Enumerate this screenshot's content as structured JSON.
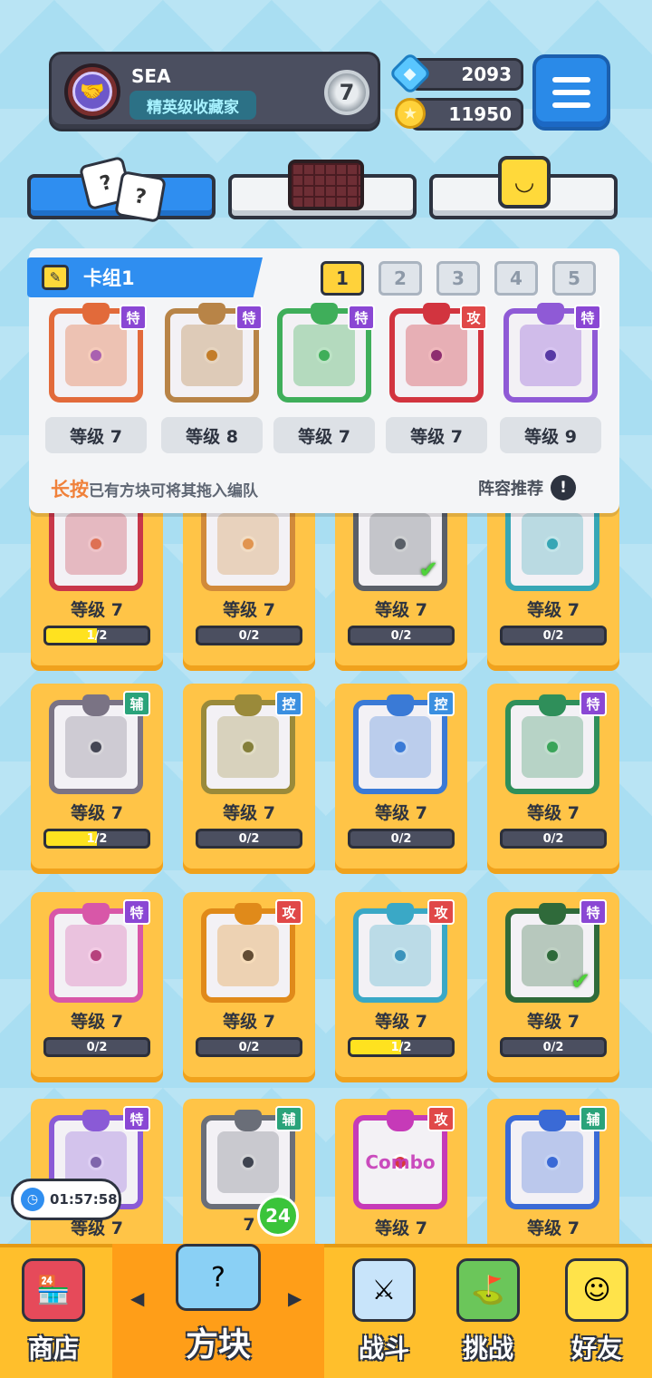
{
  "player": {
    "name": "SEA",
    "title": "精英级收藏家",
    "rank": "7"
  },
  "currency": {
    "gems": "2093",
    "coins": "11950"
  },
  "deck": {
    "label": "卡组1",
    "tabs": [
      "1",
      "2",
      "3",
      "4",
      "5"
    ],
    "active_tab": 0,
    "cards": [
      {
        "tag": "特",
        "level": "等级 7",
        "color": "#e26a3a",
        "dot": "#8a5cf0",
        "icon": "rainbow-infinity-icon"
      },
      {
        "tag": "特",
        "level": "等级 8",
        "color": "#b88447",
        "dot": "#c97a1a",
        "icon": "question-marks-icon"
      },
      {
        "tag": "特",
        "level": "等级 7",
        "color": "#3fae5a",
        "dot": "#3fae5a",
        "icon": "vines-icon"
      },
      {
        "tag": "攻",
        "level": "等级 7",
        "color": "#d2343f",
        "dot": "#6a2a8a",
        "icon": "saw-blade-icon"
      },
      {
        "tag": "特",
        "level": "等级 9",
        "color": "#8f5ad6",
        "dot": "#3a2a8a",
        "icon": "cracked-ice-icon"
      }
    ],
    "hint_highlight": "长按",
    "hint_rest": "已有方块可将其拖入编队",
    "recommend": "阵容推荐"
  },
  "collection": [
    {
      "tag": "",
      "level": "等级 7",
      "progress": "1/2",
      "fill": 0.5,
      "color": "#c8374a",
      "dot": "#e88a5a",
      "check": false,
      "icon": "sun-burst-icon"
    },
    {
      "tag": "",
      "level": "等级 7",
      "progress": "0/2",
      "fill": 0,
      "color": "#d18a3a",
      "dot": "#e89a5a",
      "check": false,
      "icon": "sand-icon"
    },
    {
      "tag": "",
      "level": "等级 7",
      "progress": "0/2",
      "fill": 0,
      "color": "#5a5f68",
      "dot": "#5a5f68",
      "check": true,
      "icon": "infinity-icon"
    },
    {
      "tag": "",
      "level": "等级 7",
      "progress": "0/2",
      "fill": 0,
      "color": "#37a7b5",
      "dot": "#37a7b5",
      "check": false,
      "icon": "trident-icon"
    },
    {
      "tag": "辅",
      "level": "等级 7",
      "progress": "1/2",
      "fill": 0.5,
      "color": "#7a7384",
      "dot": "#2d3340",
      "check": false,
      "icon": "jaws-icon"
    },
    {
      "tag": "控",
      "level": "等级 7",
      "progress": "0/2",
      "fill": 0,
      "color": "#9a8a3a",
      "dot": "#7a7a3a",
      "check": false,
      "icon": "shield-icon"
    },
    {
      "tag": "控",
      "level": "等级 7",
      "progress": "0/2",
      "fill": 0,
      "color": "#3a7ad6",
      "dot": "#3a7ad6",
      "check": false,
      "icon": "snowflake-icon"
    },
    {
      "tag": "特",
      "level": "等级 7",
      "progress": "0/2",
      "fill": 0,
      "color": "#2f8f5a",
      "dot": "#3fae5a",
      "check": false,
      "icon": "pentagram-icon"
    },
    {
      "tag": "特",
      "level": "等级 7",
      "progress": "0/2",
      "fill": 0,
      "color": "#d857a8",
      "dot": "#a83a6a",
      "check": false,
      "icon": "syringe-icon"
    },
    {
      "tag": "攻",
      "level": "等级 7",
      "progress": "0/2",
      "fill": 0,
      "color": "#e08a1a",
      "dot": "#2d3340",
      "check": false,
      "icon": "pistol-icon"
    },
    {
      "tag": "攻",
      "level": "等级 7",
      "progress": "1/2",
      "fill": 0.5,
      "color": "#3aa8c6",
      "dot": "#3a8ab8",
      "check": false,
      "icon": "vortex-icon"
    },
    {
      "tag": "特",
      "level": "等级 7",
      "progress": "0/2",
      "fill": 0,
      "color": "#2f6a3a",
      "dot": "#2f6a3a",
      "check": true,
      "icon": "dark-vines-icon"
    },
    {
      "tag": "特",
      "level": "等级 7",
      "progress": "",
      "fill": 0,
      "color": "#8a5ad6",
      "dot": "#7a6a9a",
      "check": false,
      "icon": "hole-icon"
    },
    {
      "tag": "辅",
      "level": "7",
      "progress": "",
      "fill": 0,
      "color": "#6a6e78",
      "dot": "#2d3340",
      "check": false,
      "icon": "cycle-icon"
    },
    {
      "tag": "攻",
      "level": "等级 7",
      "progress": "",
      "fill": 0,
      "color": "#c63ab8",
      "dot": "#d63a3a",
      "check": false,
      "icon": "combo-icon",
      "motif": "Combo"
    },
    {
      "tag": "辅",
      "level": "等级 7",
      "progress": "",
      "fill": 0,
      "color": "#3a6ad6",
      "dot": "#3a6ad6",
      "check": false,
      "icon": "crescent-moon-icon"
    }
  ],
  "timer": "01:57:58",
  "nav": {
    "shop": "商店",
    "blocks": "方块",
    "blocks_badge": "24",
    "battle": "战斗",
    "challenge": "挑战",
    "friends": "好友"
  }
}
